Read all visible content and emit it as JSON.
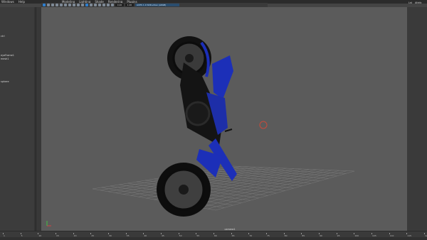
{
  "menubar": {
    "items": [
      "Windows",
      "Help",
      "Modeling",
      "Lighting",
      "Shade",
      "Rendering",
      "Plugins"
    ]
  },
  "toolbar": {
    "icons": [
      "move-icon",
      "select-icon",
      "lasso-icon",
      "paint-icon",
      "snap-grid-icon",
      "snap-curve-icon",
      "snap-point-icon",
      "camera-icon",
      "frame-icon",
      "grid-icon",
      "wireframe-icon",
      "shaded-icon",
      "texture-icon",
      "light-icon",
      "shadow-icon",
      "xray-icon",
      "isolate-icon"
    ],
    "field1": "0.00",
    "field2": "1.00",
    "camera": "ACES 1.0 SDR-video (sRGB)"
  },
  "outliner": {
    "items": [
      "",
      "",
      "",
      "",
      "",
      "",
      "",
      "ctrl",
      "",
      "",
      "",
      "",
      "eyeFrame1",
      "mesh1",
      "",
      "",
      "",
      "",
      "",
      "sphere",
      "",
      "",
      "",
      "",
      "",
      "",
      "",
      "",
      "",
      "",
      "",
      "",
      "",
      "",
      "",
      "",
      "",
      "",
      "",
      "",
      "",
      "",
      "",
      "",
      "",
      "",
      "",
      "",
      "",
      "",
      "",
      "",
      "",
      "",
      "",
      "",
      "",
      "",
      "",
      "",
      "",
      "",
      "",
      "",
      "",
      "",
      "",
      "",
      ""
    ]
  },
  "viewport": {
    "camera_label": "camera1"
  },
  "rightpanel": {
    "tabs": [
      "Lst",
      "Attrib"
    ]
  },
  "timeline": {
    "ticks": [
      "1",
      "5",
      "10",
      "15",
      "20",
      "25",
      "30",
      "35",
      "40",
      "45",
      "50",
      "55",
      "60",
      "65",
      "70",
      "75",
      "80",
      "85",
      "90",
      "95",
      "100",
      "105",
      "110",
      "115",
      "120"
    ]
  },
  "colors": {
    "viewport_bg": "#5b5b5b",
    "bike_blue": "#1c2fb8",
    "accent": "#2d7fd1"
  }
}
